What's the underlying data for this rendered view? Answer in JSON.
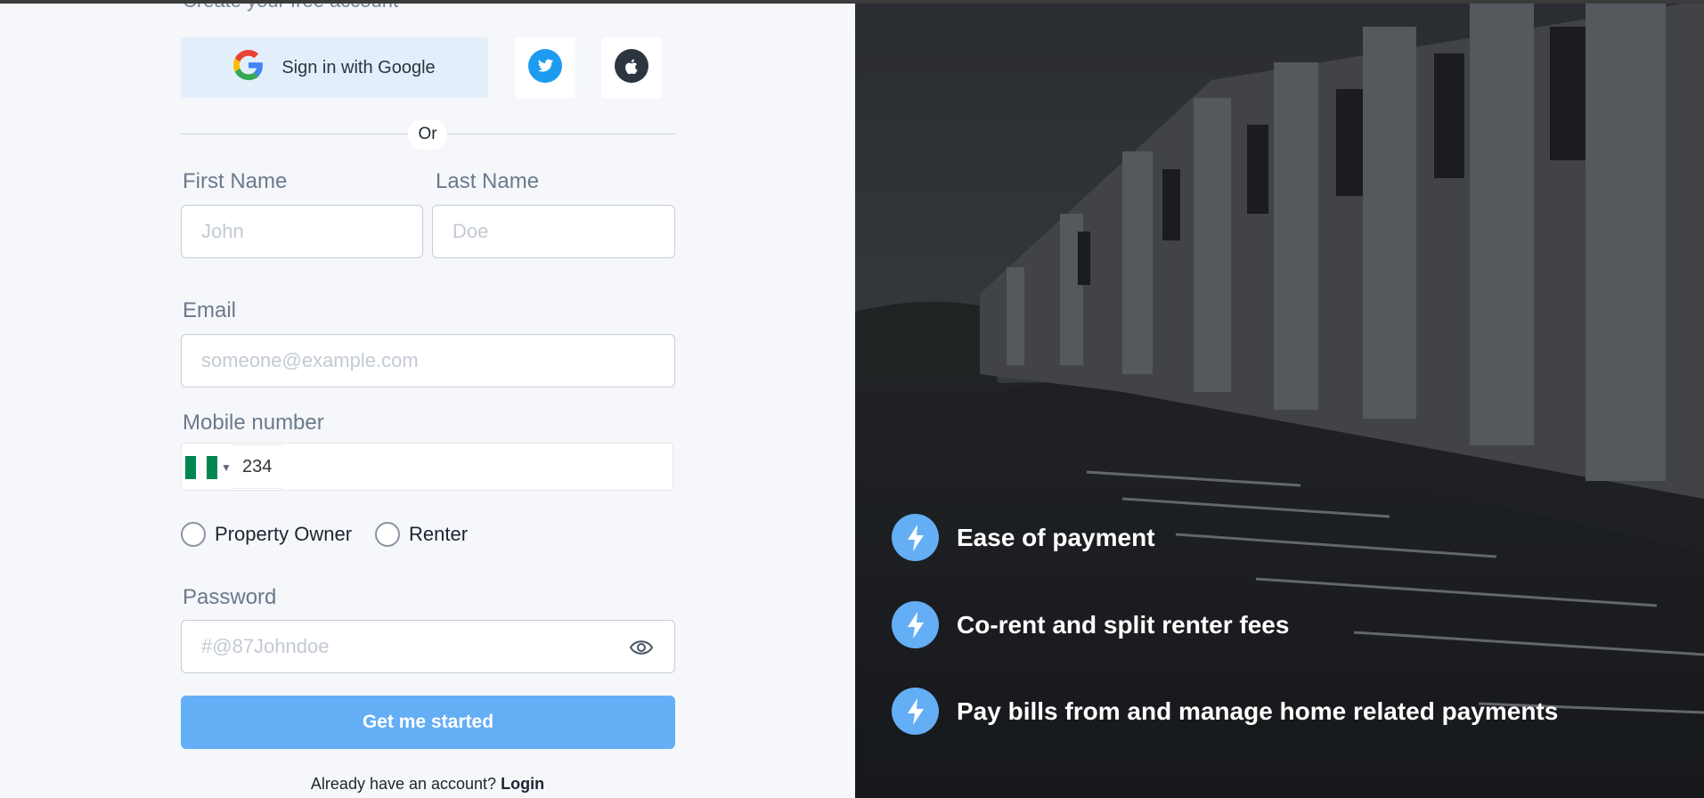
{
  "auth": {
    "cut_off_heading": "Create your free account",
    "google_label": "Sign in with Google",
    "divider_text": "Or"
  },
  "form": {
    "first_name_label": "First Name",
    "first_name_placeholder": "John",
    "last_name_label": "Last Name",
    "last_name_placeholder": "Doe",
    "email_label": "Email",
    "email_placeholder": "someone@example.com",
    "mobile_label": "Mobile number",
    "dial_code": "234",
    "role_owner": "Property Owner",
    "role_renter": "Renter",
    "password_label": "Password",
    "password_placeholder": "#@87Johndoe",
    "submit_label": "Get me started",
    "login_prompt": "Already have an account?",
    "login_link": "Login"
  },
  "features": [
    {
      "icon": "lightning-icon",
      "text": "Ease of payment"
    },
    {
      "icon": "lightning-icon",
      "text": "Co-rent and split renter fees"
    },
    {
      "icon": "lightning-icon",
      "text": "Pay bills from and manage home related payments"
    }
  ],
  "colors": {
    "primary": "#64aef5",
    "google_btn_bg": "#e2eefa",
    "twitter_blue": "#1d9bf0",
    "flag_green": "#008751"
  }
}
